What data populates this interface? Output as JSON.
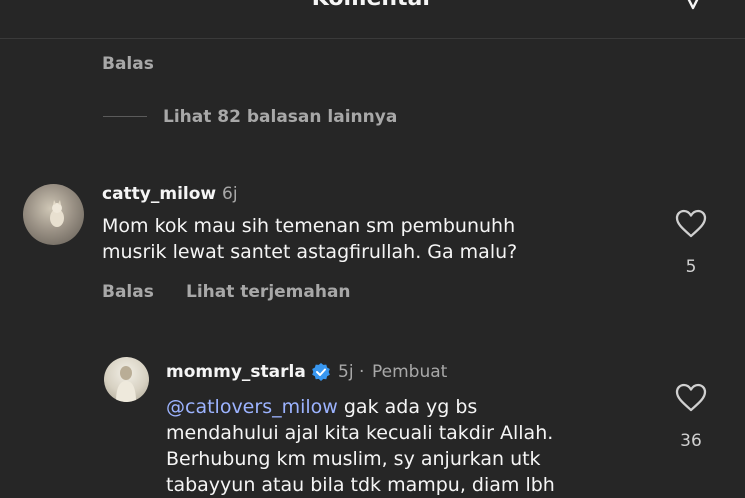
{
  "header": {
    "title": "Komentar"
  },
  "top_actions": {
    "reply": "Balas"
  },
  "view_replies": {
    "label": "Lihat 82 balasan lainnya"
  },
  "comments": [
    {
      "username": "catty_milow",
      "time": "6j",
      "text_lines": [
        "Mom kok mau sih temenan sm pembunuhh",
        "musrik lewat santet astagfirullah. Ga malu?"
      ],
      "reply_label": "Balas",
      "translate_label": "Lihat terjemahan",
      "likes": "5"
    },
    {
      "username": "mommy_starla",
      "time": "5j",
      "separator": "·",
      "author_label": "Pembuat",
      "mention": "@catlovers_milow",
      "text_first_rest": " gak ada yg bs",
      "text_lines": [
        "mendahului ajal kita kecuali takdir Allah.",
        "Berhubung km muslim, sy anjurkan utk",
        "tabayyun atau bila tdk mampu, diam lbh"
      ],
      "likes": "36",
      "verified": true
    }
  ],
  "colors": {
    "background": "#262626",
    "text": "#f5f5f5",
    "muted": "#a8a8a8",
    "mention": "#9cb3ff",
    "verified": "#3897f0"
  }
}
